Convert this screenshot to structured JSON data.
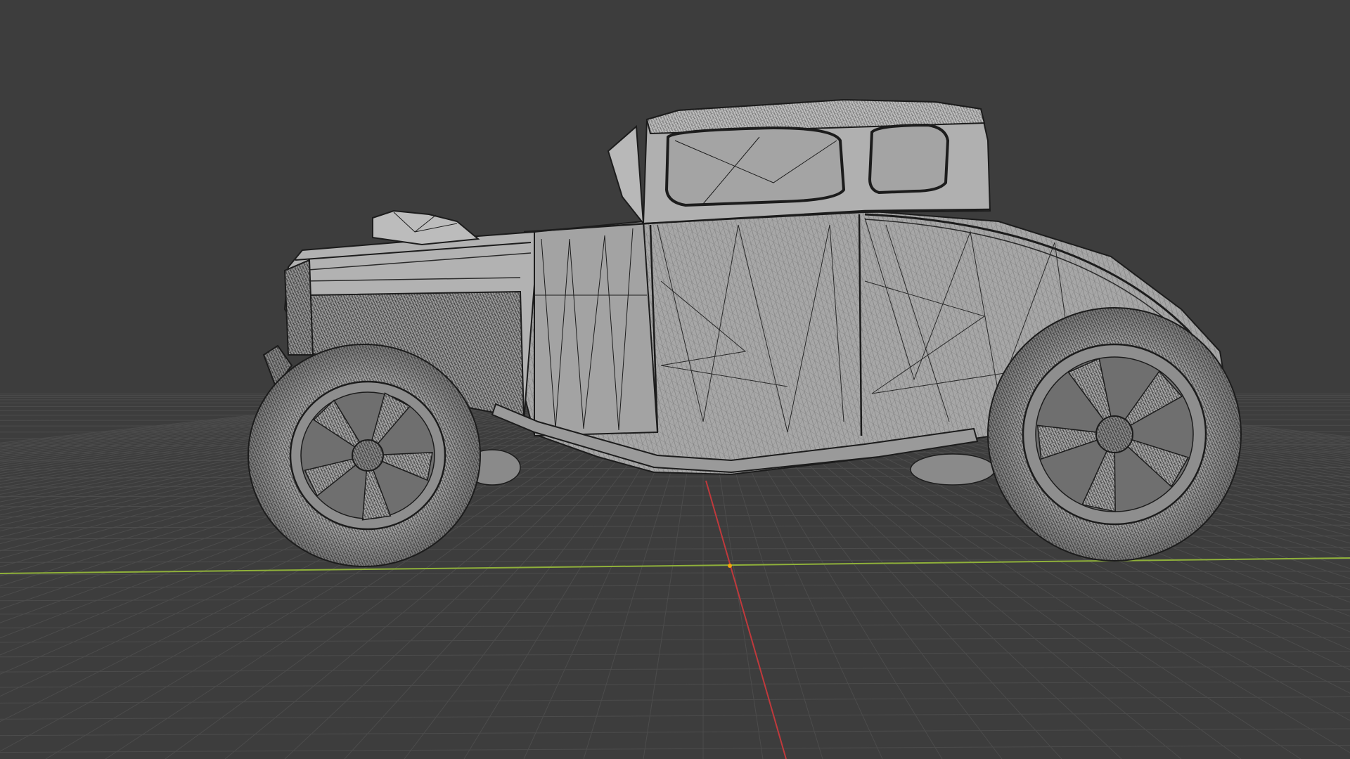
{
  "viewport": {
    "mode": "3d-viewport",
    "shading": "solid-with-wireframe-overlay",
    "object": "hot-rod-coupe-model",
    "colors": {
      "background": "#3d3d3d",
      "grid_line": "#4a4a4a",
      "x_axis": "#8fb03a",
      "y_axis": "#c0393c",
      "mesh_face": "#a9a9a9",
      "mesh_face_light": "#bdbdbd",
      "mesh_face_dark": "#8c8c8c",
      "wire": "#1c1c1c",
      "origin": "#f0a30a"
    }
  }
}
